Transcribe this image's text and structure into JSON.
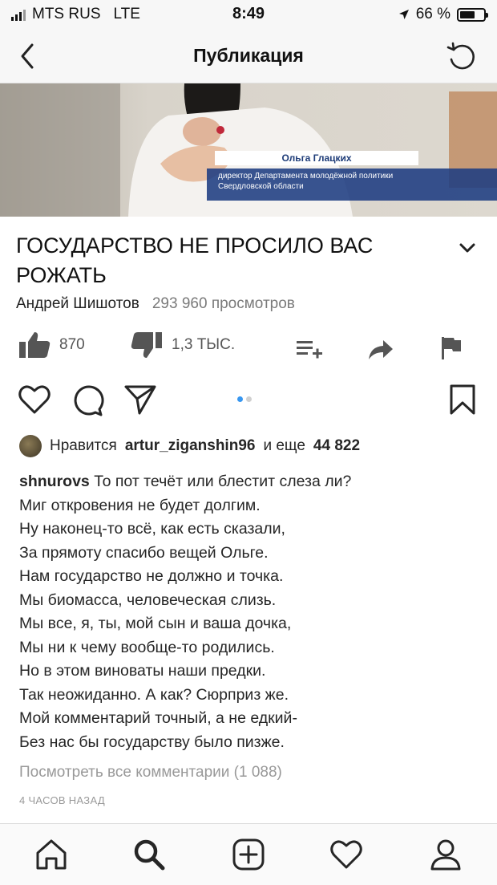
{
  "status_bar": {
    "carrier": "MTS RUS",
    "network": "LTE",
    "time": "8:49",
    "battery": "66 %",
    "battery_level": 0.66
  },
  "header": {
    "title": "Публикация",
    "back_icon": "chevron-left-icon",
    "reload_icon": "reload-icon"
  },
  "video": {
    "caption_name": "Ольга Глацких",
    "caption_role_line1": "директор Департамента молодёжной политики",
    "caption_role_line2": "Свердловской области",
    "title": "ГОСУДАРСТВО НЕ ПРОСИЛО ВАС РОЖАТЬ",
    "channel": "Андрей Шишотов",
    "views": "293 960 просмотров",
    "likes": "870",
    "dislikes": "1,3 ТЫС."
  },
  "post": {
    "liked_by_prefix": "Нравится",
    "liked_by_user": "artur_ziganshin96",
    "liked_by_middle": "и еще",
    "liked_by_count": "44 822",
    "author": "shnurovs",
    "caption_lines": [
      "То пот течёт или блестит слеза ли?",
      "Миг откровения не будет долгим.",
      "Ну наконец-то всё, как есть сказали,",
      "За прямоту спасибо вещей Ольге.",
      "Нам государство не должно и точка.",
      "Мы биомасса, человеческая слизь.",
      "Мы все, я, ты, мой сын и ваша дочка,",
      "Мы ни к чему вообще-то родились.",
      "Но в этом виноваты наши предки.",
      "Так неожиданно. А как? Сюрприз же.",
      "Мой комментарий точный, а не едкий-",
      "Без нас бы государству было пизже."
    ],
    "view_comments": "Посмотреть все комментарии (1 088)",
    "time_ago": "4 ЧАСОВ НАЗАД"
  },
  "colors": {
    "accent": "#3897f0",
    "muted": "#999999",
    "video_caption_bg": "#1e3c82"
  }
}
